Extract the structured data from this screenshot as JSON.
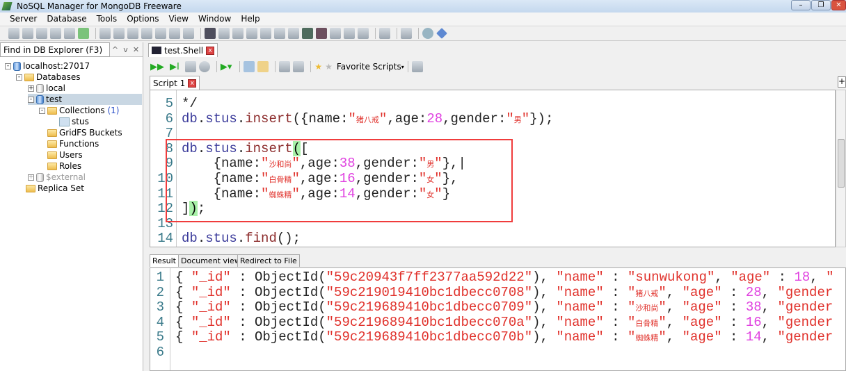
{
  "window": {
    "title": "NoSQL Manager for MongoDB Freeware"
  },
  "menu": [
    "Server",
    "Database",
    "Tools",
    "Options",
    "View",
    "Window",
    "Help"
  ],
  "explorer": {
    "find_placeholder": "Find in DB Explorer (F3)",
    "tree": {
      "server": "localhost:27017",
      "databases": "Databases",
      "local": "local",
      "test": "test",
      "collections": "Collections",
      "collections_count": "(1)",
      "stus": "stus",
      "gridfs": "GridFS Buckets",
      "functions": "Functions",
      "users": "Users",
      "roles": "Roles",
      "external": "$external",
      "replica": "Replica Set"
    }
  },
  "shell_tab": "test.Shell",
  "shell_toolbar": {
    "favorite_scripts": "Favorite Scripts"
  },
  "script_tab": "Script 1",
  "editor": {
    "lines": [
      {
        "n": "5",
        "t": [
          [
            "pl",
            "*/"
          ]
        ]
      },
      {
        "n": "6",
        "t": [
          [
            "obj",
            "db"
          ],
          [
            "pl",
            "."
          ],
          [
            "obj",
            "stus"
          ],
          [
            "pl",
            "."
          ],
          [
            "kw",
            "insert"
          ],
          [
            "pl",
            "({name:"
          ],
          [
            "str",
            "\""
          ],
          [
            "cjk",
            "猪八戒"
          ],
          [
            "str",
            "\""
          ],
          [
            "pl",
            ",age:"
          ],
          [
            "num",
            "28"
          ],
          [
            "pl",
            ",gender:"
          ],
          [
            "str",
            "\""
          ],
          [
            "cjk",
            "男"
          ],
          [
            "str",
            "\""
          ],
          [
            "pl",
            "});"
          ]
        ]
      },
      {
        "n": "7",
        "t": []
      },
      {
        "n": "8",
        "t": [
          [
            "obj",
            "db"
          ],
          [
            "pl",
            "."
          ],
          [
            "obj",
            "stus"
          ],
          [
            "pl",
            "."
          ],
          [
            "kw",
            "insert"
          ],
          [
            "br",
            "("
          ],
          [
            "pl",
            "["
          ]
        ]
      },
      {
        "n": "9",
        "t": [
          [
            "pl",
            "    {name:"
          ],
          [
            "str",
            "\""
          ],
          [
            "cjk",
            "沙和尚"
          ],
          [
            "str",
            "\""
          ],
          [
            "pl",
            ",age:"
          ],
          [
            "num",
            "38"
          ],
          [
            "pl",
            ",gender:"
          ],
          [
            "str",
            "\""
          ],
          [
            "cjk",
            "男"
          ],
          [
            "str",
            "\""
          ],
          [
            "pl",
            "},|"
          ]
        ]
      },
      {
        "n": "10",
        "t": [
          [
            "pl",
            "    {name:"
          ],
          [
            "str",
            "\""
          ],
          [
            "cjk",
            "白骨精"
          ],
          [
            "str",
            "\""
          ],
          [
            "pl",
            ",age:"
          ],
          [
            "num",
            "16"
          ],
          [
            "pl",
            ",gender:"
          ],
          [
            "str",
            "\""
          ],
          [
            "cjk",
            "女"
          ],
          [
            "str",
            "\""
          ],
          [
            "pl",
            "},"
          ]
        ]
      },
      {
        "n": "11",
        "t": [
          [
            "pl",
            "    {name:"
          ],
          [
            "str",
            "\""
          ],
          [
            "cjk",
            "蜘蛛精"
          ],
          [
            "str",
            "\""
          ],
          [
            "pl",
            ",age:"
          ],
          [
            "num",
            "14"
          ],
          [
            "pl",
            ",gender:"
          ],
          [
            "str",
            "\""
          ],
          [
            "cjk",
            "女"
          ],
          [
            "str",
            "\""
          ],
          [
            "pl",
            "}"
          ]
        ]
      },
      {
        "n": "12",
        "t": [
          [
            "pl",
            "]"
          ],
          [
            "br",
            ")"
          ],
          [
            "pl",
            ";"
          ]
        ]
      },
      {
        "n": "13",
        "t": []
      },
      {
        "n": "14",
        "t": [
          [
            "obj",
            "db"
          ],
          [
            "pl",
            "."
          ],
          [
            "obj",
            "stus"
          ],
          [
            "pl",
            "."
          ],
          [
            "kw",
            "find"
          ],
          [
            "pl",
            "();"
          ]
        ]
      }
    ]
  },
  "result_tabs": [
    "Result",
    "Document view",
    "Redirect to File"
  ],
  "results": {
    "lines": [
      {
        "n": "1",
        "t": [
          [
            "pl",
            "{ "
          ],
          [
            "str",
            "\"_id\""
          ],
          [
            "pl",
            " : ObjectId("
          ],
          [
            "str",
            "\"59c20943f7ff2377aa592d22\""
          ],
          [
            "pl",
            "), "
          ],
          [
            "str",
            "\"name\""
          ],
          [
            "pl",
            " : "
          ],
          [
            "str",
            "\"sunwukong\""
          ],
          [
            "pl",
            ", "
          ],
          [
            "str",
            "\"age\""
          ],
          [
            "pl",
            " : "
          ],
          [
            "num",
            "18"
          ],
          [
            "pl",
            ", "
          ],
          [
            "str",
            "\""
          ]
        ]
      },
      {
        "n": "2",
        "t": [
          [
            "pl",
            "{ "
          ],
          [
            "str",
            "\"_id\""
          ],
          [
            "pl",
            " : ObjectId("
          ],
          [
            "str",
            "\"59c219019410bc1dbecc0708\""
          ],
          [
            "pl",
            "), "
          ],
          [
            "str",
            "\"name\""
          ],
          [
            "pl",
            " : "
          ],
          [
            "str",
            "\""
          ],
          [
            "cjk",
            "猪八戒"
          ],
          [
            "str",
            "\""
          ],
          [
            "pl",
            ", "
          ],
          [
            "str",
            "\"age\""
          ],
          [
            "pl",
            " : "
          ],
          [
            "num",
            "28"
          ],
          [
            "pl",
            ", "
          ],
          [
            "str",
            "\"gender"
          ]
        ]
      },
      {
        "n": "3",
        "t": [
          [
            "pl",
            "{ "
          ],
          [
            "str",
            "\"_id\""
          ],
          [
            "pl",
            " : ObjectId("
          ],
          [
            "str",
            "\"59c219689410bc1dbecc0709\""
          ],
          [
            "pl",
            "), "
          ],
          [
            "str",
            "\"name\""
          ],
          [
            "pl",
            " : "
          ],
          [
            "str",
            "\""
          ],
          [
            "cjk",
            "沙和尚"
          ],
          [
            "str",
            "\""
          ],
          [
            "pl",
            ", "
          ],
          [
            "str",
            "\"age\""
          ],
          [
            "pl",
            " : "
          ],
          [
            "num",
            "38"
          ],
          [
            "pl",
            ", "
          ],
          [
            "str",
            "\"gender"
          ]
        ]
      },
      {
        "n": "4",
        "t": [
          [
            "pl",
            "{ "
          ],
          [
            "str",
            "\"_id\""
          ],
          [
            "pl",
            " : ObjectId("
          ],
          [
            "str",
            "\"59c219689410bc1dbecc070a\""
          ],
          [
            "pl",
            "), "
          ],
          [
            "str",
            "\"name\""
          ],
          [
            "pl",
            " : "
          ],
          [
            "str",
            "\""
          ],
          [
            "cjk",
            "白骨精"
          ],
          [
            "str",
            "\""
          ],
          [
            "pl",
            ", "
          ],
          [
            "str",
            "\"age\""
          ],
          [
            "pl",
            " : "
          ],
          [
            "num",
            "16"
          ],
          [
            "pl",
            ", "
          ],
          [
            "str",
            "\"gender"
          ]
        ]
      },
      {
        "n": "5",
        "t": [
          [
            "pl",
            "{ "
          ],
          [
            "str",
            "\"_id\""
          ],
          [
            "pl",
            " : ObjectId("
          ],
          [
            "str",
            "\"59c219689410bc1dbecc070b\""
          ],
          [
            "pl",
            "), "
          ],
          [
            "str",
            "\"name\""
          ],
          [
            "pl",
            " : "
          ],
          [
            "str",
            "\""
          ],
          [
            "cjk",
            "蜘蛛精"
          ],
          [
            "str",
            "\""
          ],
          [
            "pl",
            ", "
          ],
          [
            "str",
            "\"age\""
          ],
          [
            "pl",
            " : "
          ],
          [
            "num",
            "14"
          ],
          [
            "pl",
            ", "
          ],
          [
            "str",
            "\"gender"
          ]
        ]
      },
      {
        "n": "6",
        "t": []
      }
    ]
  }
}
